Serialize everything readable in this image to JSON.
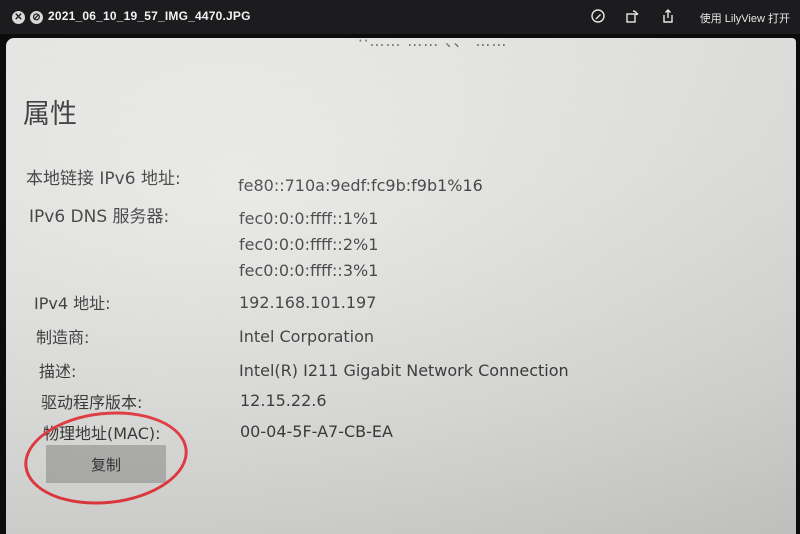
{
  "titlebar": {
    "close_glyph": "✕",
    "min_glyph": "⊘",
    "filename": "2021_06_10_19_57_IMG_4470.JPG",
    "icons": [
      "annotate-icon",
      "rotate-icon",
      "share-icon"
    ],
    "open_with": "使用 LilyView 打开"
  },
  "photo": {
    "cutoff_top_text": "··…… …… 、、 ……",
    "heading": "属性",
    "properties": [
      {
        "label": "本地链接 IPv6 地址:",
        "values": [
          "fe80::710a:9edf:fc9b:f9b1%16"
        ]
      },
      {
        "label": "IPv6 DNS 服务器:",
        "values": [
          "fec0:0:0:ffff::1%1",
          "fec0:0:0:ffff::2%1",
          "fec0:0:0:ffff::3%1"
        ]
      },
      {
        "label": "IPv4 地址:",
        "values": [
          "192.168.101.197"
        ]
      },
      {
        "label": "制造商:",
        "values": [
          "Intel Corporation"
        ]
      },
      {
        "label": "描述:",
        "values": [
          "Intel(R) I211 Gigabit Network Connection"
        ]
      },
      {
        "label": "驱动程序版本:",
        "values": [
          "12.15.22.6"
        ]
      },
      {
        "label": "物理地址(MAC):",
        "values": [
          "00-04-5F-A7-CB-EA"
        ]
      }
    ],
    "copy_button": "复制",
    "annotation_color": "#e0242b"
  }
}
